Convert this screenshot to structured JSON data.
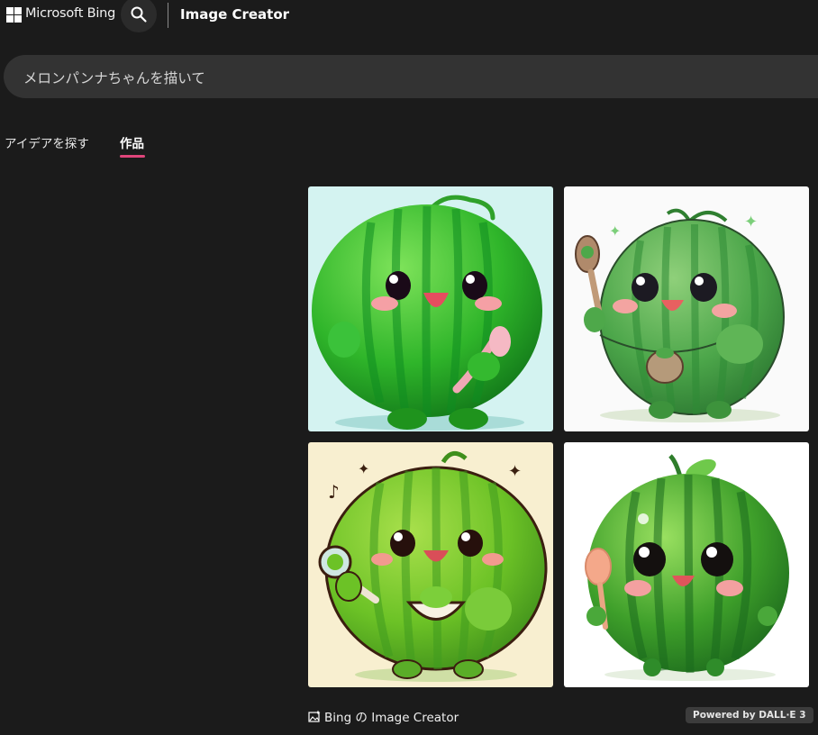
{
  "header": {
    "brand": "Microsoft Bing",
    "app_title": "Image Creator",
    "search_icon": "search-icon"
  },
  "prompt": {
    "value": "メロンパンナちゃんを描いて"
  },
  "tabs": [
    {
      "label": "アイデアを探す",
      "active": false
    },
    {
      "label": "作品",
      "active": true
    }
  ],
  "accent_color": "#e0457b",
  "images": [
    {
      "description_icon": "watermelon-character-spoon",
      "background": "#d4f3f1"
    },
    {
      "description_icon": "watermelon-character-spoon-bag",
      "background": "#fafafa"
    },
    {
      "description_icon": "watermelon-character-bowl",
      "background": "#f8efd0"
    },
    {
      "description_icon": "watermelon-character-spoon-leaf",
      "background": "#ffffff"
    }
  ],
  "footer": {
    "creator_label": "Bing の Image Creator",
    "creator_icon": "image-sparkle-icon",
    "badge": "Powered by DALL·E 3"
  }
}
